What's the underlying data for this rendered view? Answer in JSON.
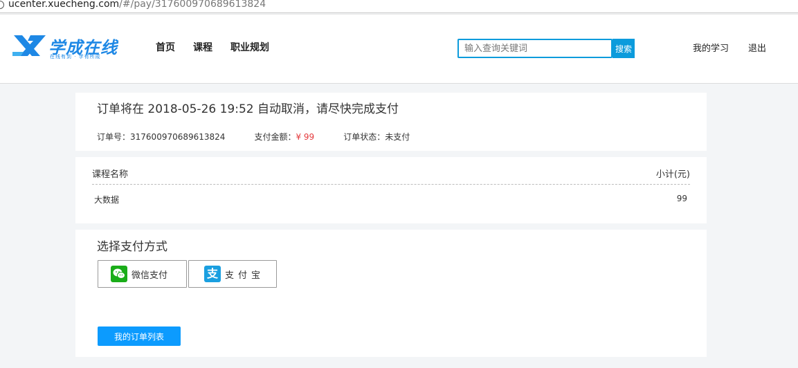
{
  "browser": {
    "url_host": "ucenter.xuecheng.com",
    "url_path": "/#/pay/317600970689613824"
  },
  "header": {
    "logo_text": "学成在线",
    "logo_slogan": "在线有到 · 学有所成",
    "nav": [
      "首页",
      "课程",
      "职业规划"
    ],
    "search_placeholder": "输入查询关键词",
    "search_button": "搜索",
    "user_links": [
      "我的学习",
      "退出"
    ]
  },
  "order": {
    "notice": "订单将在 2018-05-26 19:52 自动取消，请尽快完成支付",
    "number_label": "订单号：",
    "number": "317600970689613824",
    "amount_label": "支付金额：",
    "amount": "¥ 99",
    "status_label": "订单状态：",
    "status": "未支付"
  },
  "items_table": {
    "headers": [
      "课程名称",
      "小计(元)"
    ],
    "rows": [
      {
        "name": "大数据",
        "subtotal": "99"
      }
    ]
  },
  "payment": {
    "title": "选择支付方式",
    "wechat_label": "微信支付",
    "alipay_label": "支付宝",
    "alipay_icon_glyph": "支",
    "orders_button": "我的订单列表"
  },
  "colors": {
    "brand_blue": "#0c9bdc",
    "button_blue": "#0c9bfe",
    "price_red": "#e4393c",
    "wechat_green": "#1aad19",
    "alipay_blue": "#1a9fe0"
  },
  "icons": [
    "info-icon",
    "logo-mark-icon",
    "wechat-icon",
    "alipay-icon"
  ]
}
